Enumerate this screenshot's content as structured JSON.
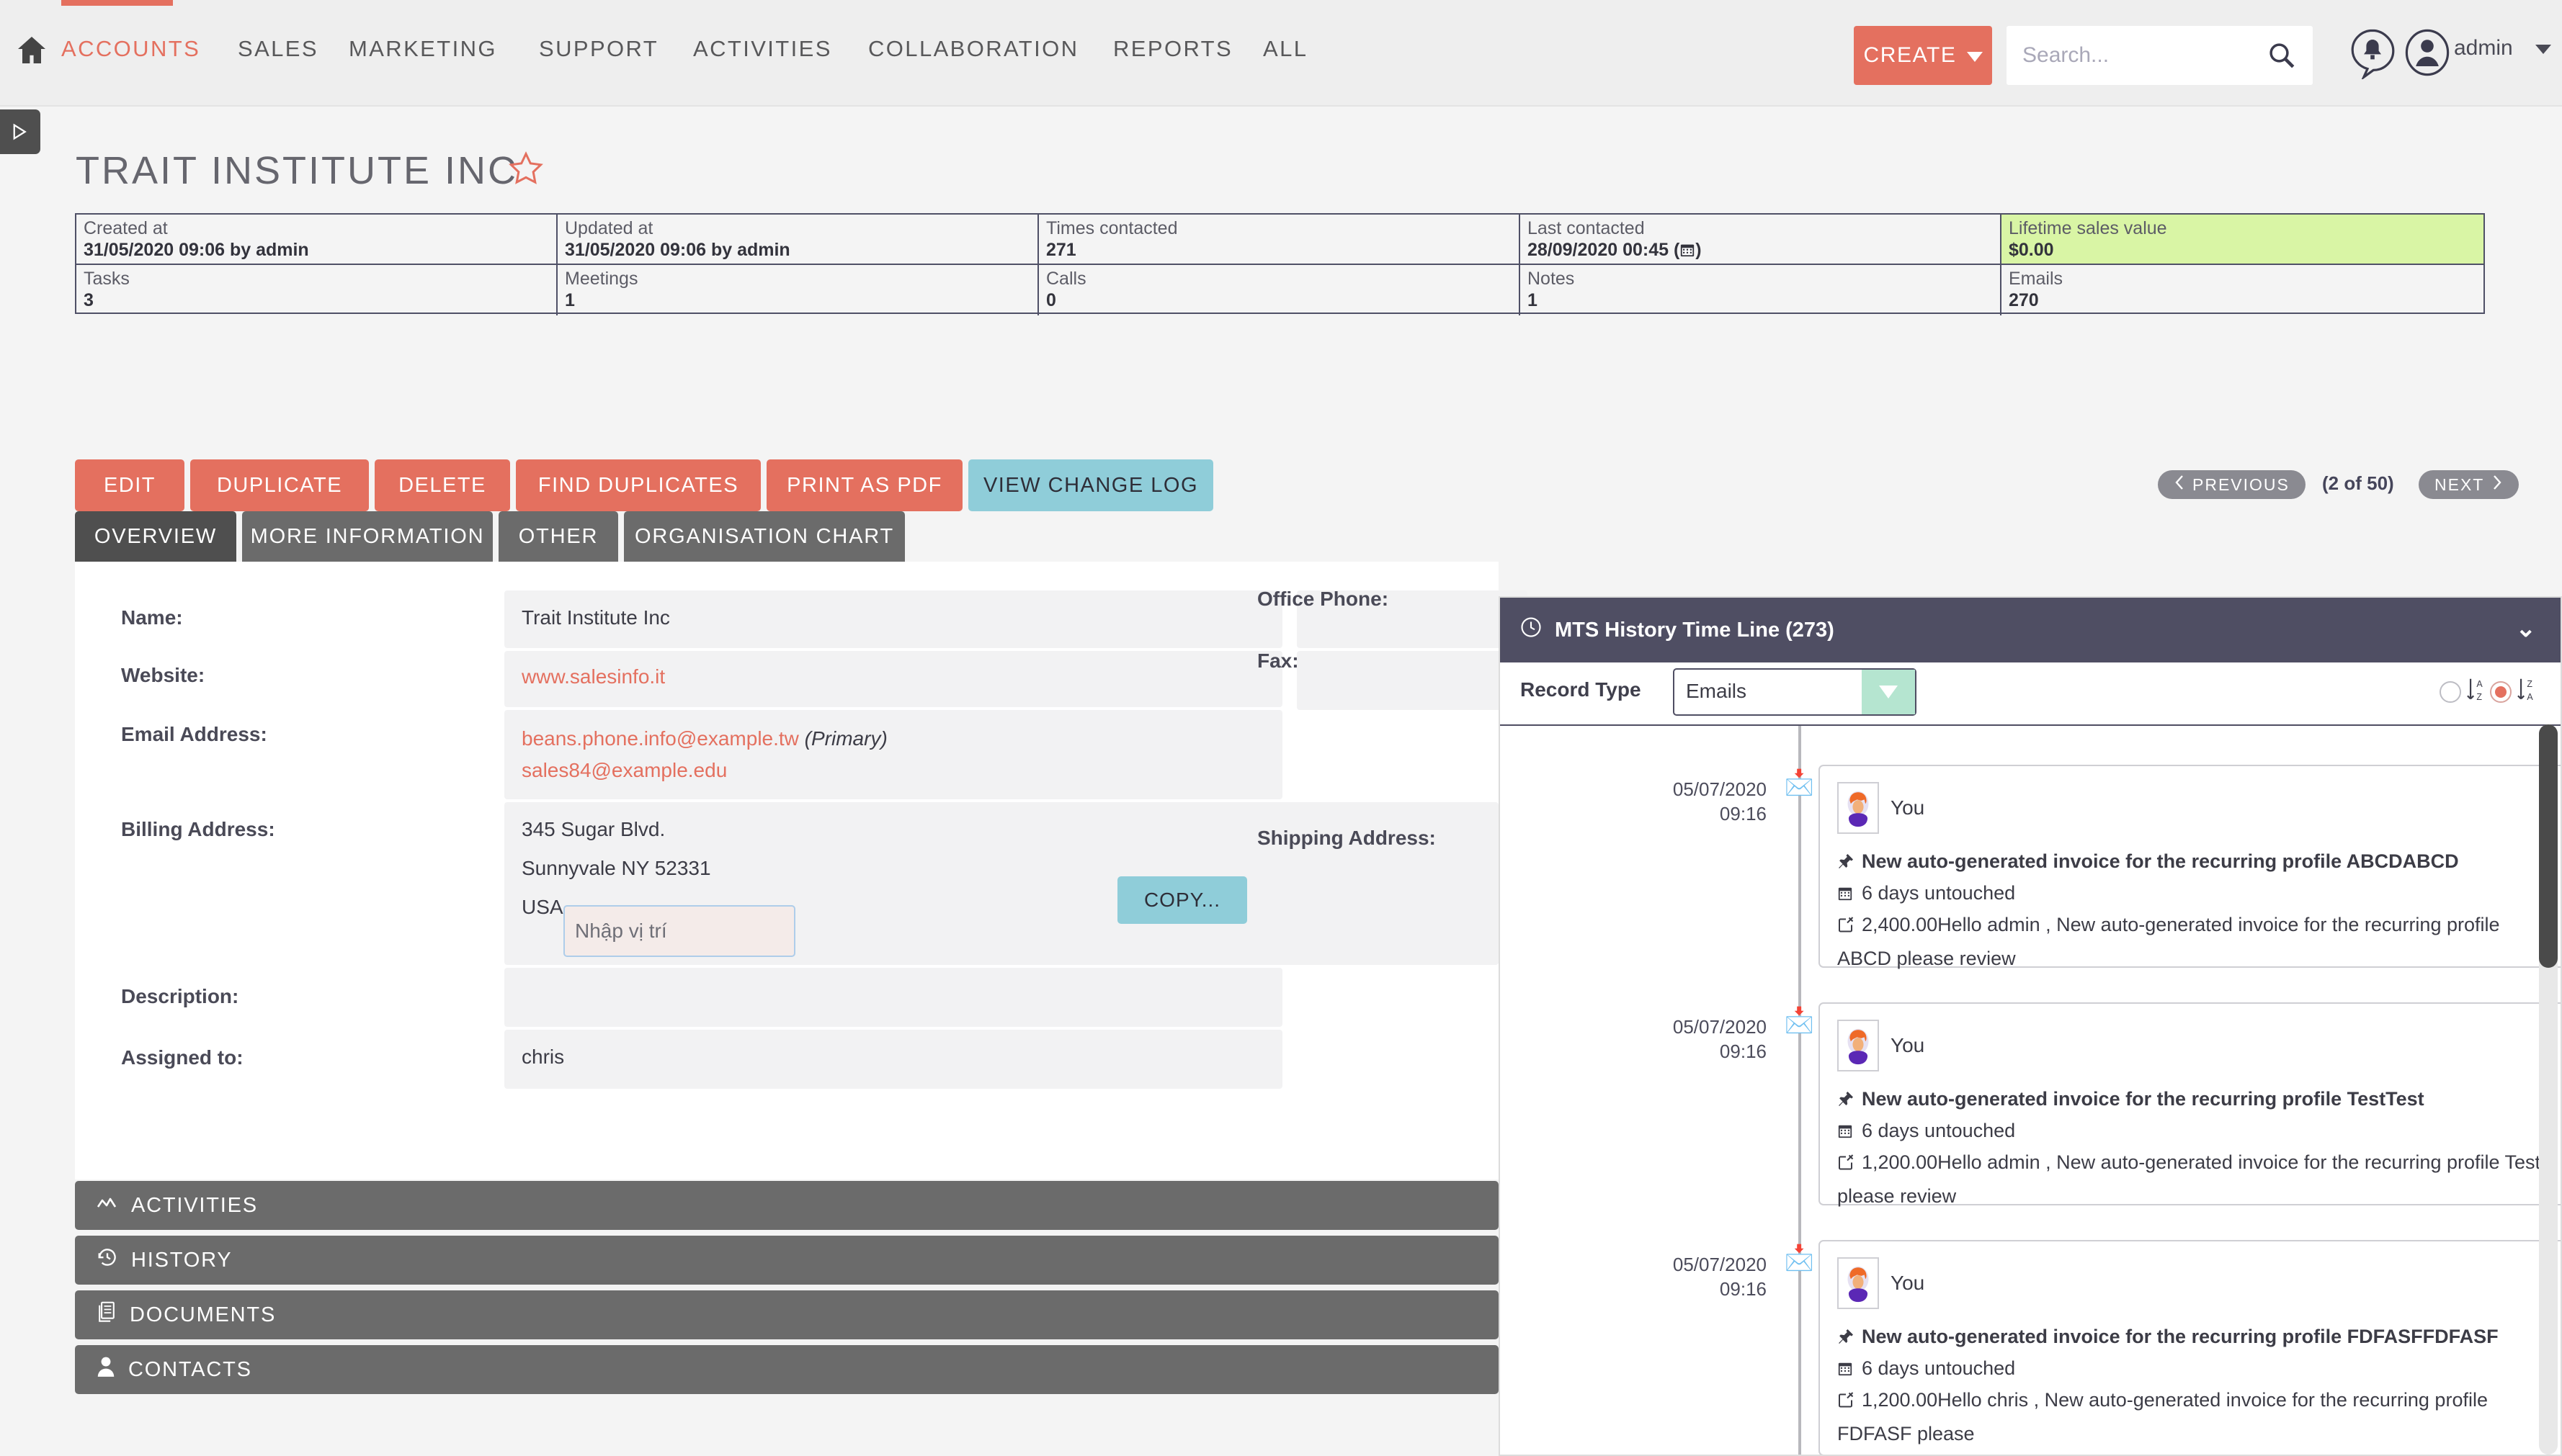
{
  "topnav": {
    "home_icon": "home-icon",
    "items": [
      {
        "label": "ACCOUNTS",
        "active": true
      },
      {
        "label": "SALES",
        "active": false
      },
      {
        "label": "MARKETING",
        "active": false
      },
      {
        "label": "SUPPORT",
        "active": false
      },
      {
        "label": "ACTIVITIES",
        "active": false
      },
      {
        "label": "COLLABORATION",
        "active": false
      },
      {
        "label": "REPORTS",
        "active": false
      },
      {
        "label": "ALL",
        "active": false
      }
    ],
    "create_label": "CREATE",
    "search_placeholder": "Search...",
    "search_value": "",
    "user_label": "admin",
    "accent_color": "#e4705f"
  },
  "record": {
    "title": "TRAIT INSTITUTE INC",
    "favourite_icon": "star-icon"
  },
  "info_grid": [
    {
      "label": "Created at",
      "value": "31/05/2020 09:06 by admin",
      "highlight": false
    },
    {
      "label": "Updated at",
      "value": "31/05/2020 09:06 by admin",
      "highlight": false
    },
    {
      "label": "Times contacted",
      "value": "271",
      "highlight": false
    },
    {
      "label": "Last contacted",
      "value": "28/09/2020 00:45 (",
      "value_suffix": ")",
      "has_calendar_icon": true,
      "highlight": false
    },
    {
      "label": "Lifetime sales value",
      "value": "$0.00",
      "highlight": true
    },
    {
      "label": "Tasks",
      "value": "3",
      "highlight": false
    },
    {
      "label": "Meetings",
      "value": "1",
      "highlight": false
    },
    {
      "label": "Calls",
      "value": "0",
      "highlight": false
    },
    {
      "label": "Notes",
      "value": "1",
      "highlight": false
    },
    {
      "label": "Emails",
      "value": "270",
      "highlight": false
    }
  ],
  "actions": [
    {
      "label": "EDIT",
      "style": "red"
    },
    {
      "label": "DUPLICATE",
      "style": "red"
    },
    {
      "label": "DELETE",
      "style": "red"
    },
    {
      "label": "FIND DUPLICATES",
      "style": "red"
    },
    {
      "label": "PRINT AS PDF",
      "style": "red"
    },
    {
      "label": "VIEW CHANGE LOG",
      "style": "teal"
    }
  ],
  "pager": {
    "previous_label": "PREVIOUS",
    "next_label": "NEXT",
    "count_label": "(2 of 50)"
  },
  "tabs": [
    {
      "label": "OVERVIEW",
      "active": true
    },
    {
      "label": "MORE INFORMATION",
      "active": false
    },
    {
      "label": "OTHER",
      "active": false
    },
    {
      "label": "ORGANISATION CHART",
      "active": false
    }
  ],
  "form": {
    "name_label": "Name:",
    "name_value": "Trait Institute Inc",
    "website_label": "Website:",
    "website_value": "www.salesinfo.it",
    "email_label": "Email Address:",
    "email_primary": "beans.phone.info@example.tw",
    "email_primary_note": "(Primary)",
    "email_secondary": "sales84@example.edu",
    "billing_label": "Billing Address:",
    "billing_line1": "345 Sugar Blvd.",
    "billing_line2": "Sunnyvale NY  52331",
    "billing_country": "USA",
    "location_placeholder": "Nhập vị trí",
    "location_value": "",
    "copy_label": "COPY...",
    "description_label": "Description:",
    "description_value": "",
    "assigned_label": "Assigned to:",
    "assigned_value": "chris",
    "office_phone_label": "Office Phone:",
    "office_phone_value": "",
    "fax_label": "Fax:",
    "fax_value": "",
    "shipping_label": "Shipping Address:",
    "shipping_value": ""
  },
  "accordions": [
    {
      "label": "ACTIVITIES",
      "icon": "activities-icon"
    },
    {
      "label": "HISTORY",
      "icon": "history-icon"
    },
    {
      "label": "DOCUMENTS",
      "icon": "documents-icon"
    },
    {
      "label": "CONTACTS",
      "icon": "contacts-icon"
    }
  ],
  "timeline": {
    "header_title": "MTS History Time Line (273)",
    "header_icon": "clock-icon",
    "collapse_icon": "chevron-down-icon",
    "record_type_label": "Record Type",
    "record_type_value": "Emails",
    "sort_asc_selected": false,
    "sort_desc_selected": true,
    "entries": [
      {
        "date": "05/07/2020",
        "time": "09:16",
        "marker_icon": "envelope-icon",
        "user": "You",
        "subject": "New auto-generated invoice for the recurring profile ABCDABCD",
        "status": "6 days untouched",
        "body": "2,400.00Hello admin , New auto-generated invoice for the recurring profile ABCD please review"
      },
      {
        "date": "05/07/2020",
        "time": "09:16",
        "marker_icon": "envelope-icon",
        "user": "You",
        "subject": "New auto-generated invoice for the recurring profile TestTest",
        "status": "6 days untouched",
        "body": "1,200.00Hello admin , New auto-generated invoice for the recurring profile Test please review"
      },
      {
        "date": "05/07/2020",
        "time": "09:16",
        "marker_icon": "envelope-icon",
        "user": "You",
        "subject": "New auto-generated invoice for the recurring profile FDFASFFDFASF",
        "status": "6 days untouched",
        "body": "1,200.00Hello chris , New auto-generated invoice for the recurring profile FDFASF please"
      }
    ]
  }
}
